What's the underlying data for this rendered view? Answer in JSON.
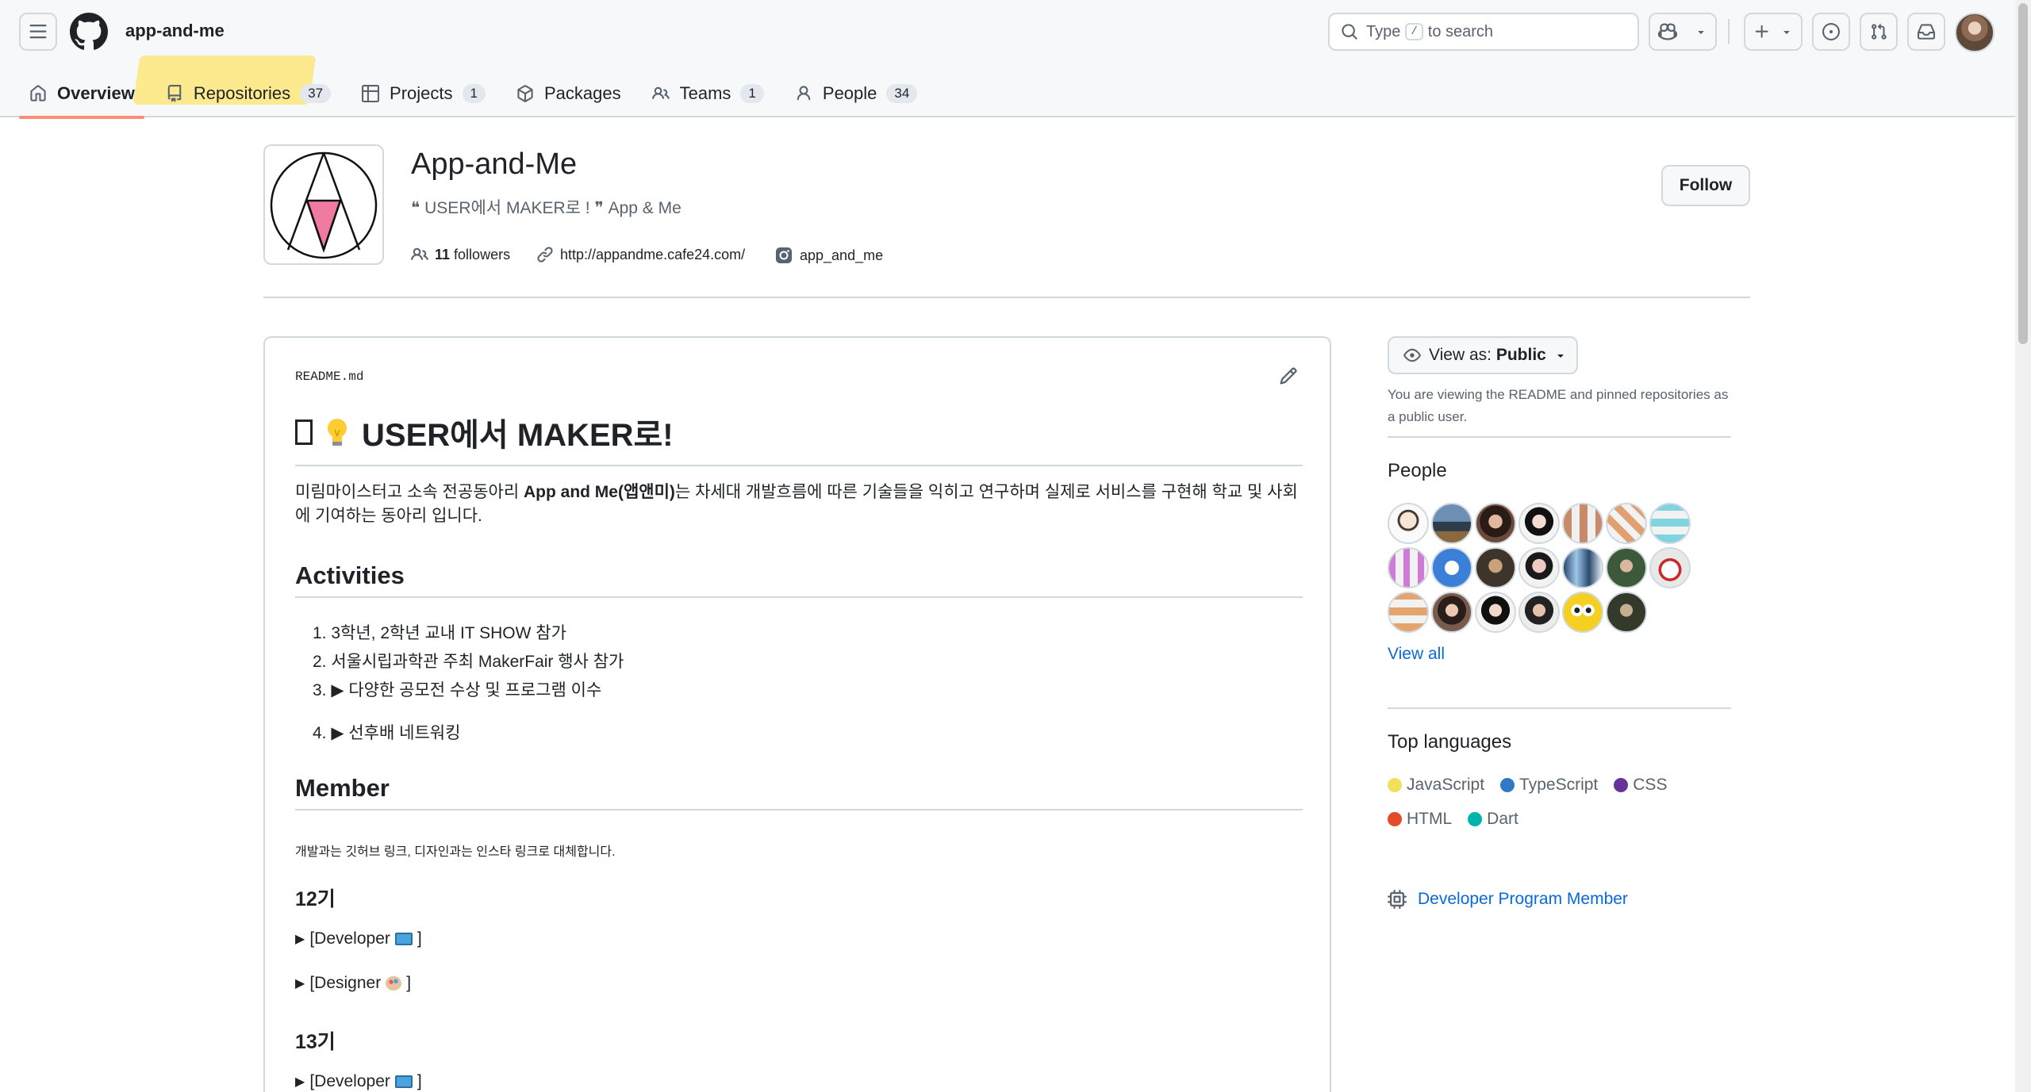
{
  "header": {
    "org_title": "app-and-me",
    "search": {
      "prefix": "Type",
      "key": "/",
      "suffix": "to search"
    }
  },
  "tabs": [
    {
      "label": "Overview",
      "icon": "home-icon",
      "counter": ""
    },
    {
      "label": "Repositories",
      "icon": "repo-icon",
      "counter": "37"
    },
    {
      "label": "Projects",
      "icon": "table-icon",
      "counter": "1"
    },
    {
      "label": "Packages",
      "icon": "package-icon",
      "counter": ""
    },
    {
      "label": "Teams",
      "icon": "people-icon",
      "counter": "1"
    },
    {
      "label": "People",
      "icon": "person-icon",
      "counter": "34"
    }
  ],
  "org": {
    "name": "App-and-Me",
    "description": "❝ USER에서 MAKER로 ! ❞ App & Me",
    "followers_count": "11",
    "followers_label": "followers",
    "website": "http://appandme.cafe24.com/",
    "instagram": "app_and_me",
    "follow_label": "Follow"
  },
  "readme": {
    "filename": "README.md",
    "title": "USER에서 MAKER로!",
    "intro_before": "미림마이스터고 소속 전공동아리 ",
    "intro_bold": "App and Me(앱앤미)",
    "intro_after": "는 차세대 개발흐름에 따른 기술들을 익히고 연구하며 실제로 서비스를 구현해 학교 및 사회에 기여하는 동아리 입니다.",
    "activities_heading": "Activities",
    "activities": [
      "1. 3학년, 2학년 교내 IT SHOW 참가",
      "2. 서울시립과학관 주최 MakerFair 행사 참가",
      "3. ▶ 다양한 공모전 수상 및 프로그램 이수",
      "4. ▶ 선후배 네트워킹"
    ],
    "member_heading": "Member",
    "member_note": "개발과는 깃허브 링크, 디자인과는 인스타 링크로 대체합니다.",
    "gen12": "12기",
    "gen13": "13기",
    "developer_label_prefix": "[Developer",
    "designer_label_prefix": "[Designer",
    "bracket_close": "]"
  },
  "sidebar": {
    "view_as_label": "View as:",
    "view_as_value": "Public",
    "view_note": "You are viewing the README and pinned repositories as a public user.",
    "people_heading": "People",
    "view_all": "View all",
    "top_languages_heading": "Top languages",
    "languages": [
      {
        "name": "JavaScript",
        "color": "#f1e05a"
      },
      {
        "name": "TypeScript",
        "color": "#3178c6"
      },
      {
        "name": "CSS",
        "color": "#663399"
      },
      {
        "name": "HTML",
        "color": "#e34c26"
      },
      {
        "name": "Dart",
        "color": "#00b4ab"
      }
    ],
    "developer_program": "Developer Program Member"
  },
  "colors": {
    "accent_link": "#0969da",
    "tab_underline": "#fd8c73",
    "border": "#d1d9e0",
    "highlight": "#ffe564"
  }
}
